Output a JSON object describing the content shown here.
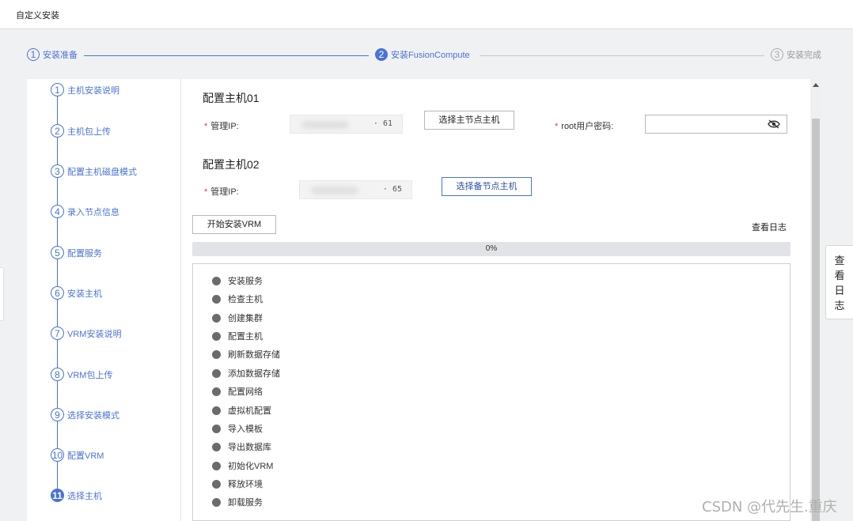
{
  "window": {
    "title": "自定义安装"
  },
  "main_steps": [
    {
      "num": "1",
      "label": "安装准备"
    },
    {
      "num": "2",
      "label": "安装FusionCompute"
    },
    {
      "num": "3",
      "label": "安装完成"
    }
  ],
  "sub_steps": [
    {
      "num": "1",
      "label": "主机安装说明"
    },
    {
      "num": "2",
      "label": "主机包上传"
    },
    {
      "num": "3",
      "label": "配置主机磁盘模式"
    },
    {
      "num": "4",
      "label": "录入节点信息"
    },
    {
      "num": "5",
      "label": "配置服务"
    },
    {
      "num": "6",
      "label": "安装主机"
    },
    {
      "num": "7",
      "label": "VRM安装说明"
    },
    {
      "num": "8",
      "label": "VRM包上传"
    },
    {
      "num": "9",
      "label": "选择安装模式"
    },
    {
      "num": "10",
      "label": "配置VRM"
    },
    {
      "num": "11",
      "label": "选择主机"
    }
  ],
  "host1": {
    "title": "配置主机01",
    "ip_label": "管理IP:",
    "ip_value": "·  61",
    "select_button": "选择主节点主机",
    "pwd_label": "root用户密码:"
  },
  "host2": {
    "title": "配置主机02",
    "ip_label": "管理IP:",
    "ip_value": "·  65",
    "select_button": "选择备节点主机"
  },
  "actions": {
    "start_button": "开始安装VRM",
    "view_log": "查看日志"
  },
  "progress": {
    "value": 0,
    "text": "0%"
  },
  "tasks": [
    "安装服务",
    "检查主机",
    "创建集群",
    "配置主机",
    "刷新数据存储",
    "添加数据存储",
    "配置网络",
    "虚拟机配置",
    "导入模板",
    "导出数据库",
    "初始化VRM",
    "释放环境",
    "卸载服务"
  ],
  "side_log": [
    "查",
    "看",
    "日",
    "志"
  ],
  "watermark": "CSDN @代先生.重庆",
  "colors": {
    "accent": "#4a73d6",
    "required": "#e03b3b",
    "dot": "#6b6b6b"
  }
}
